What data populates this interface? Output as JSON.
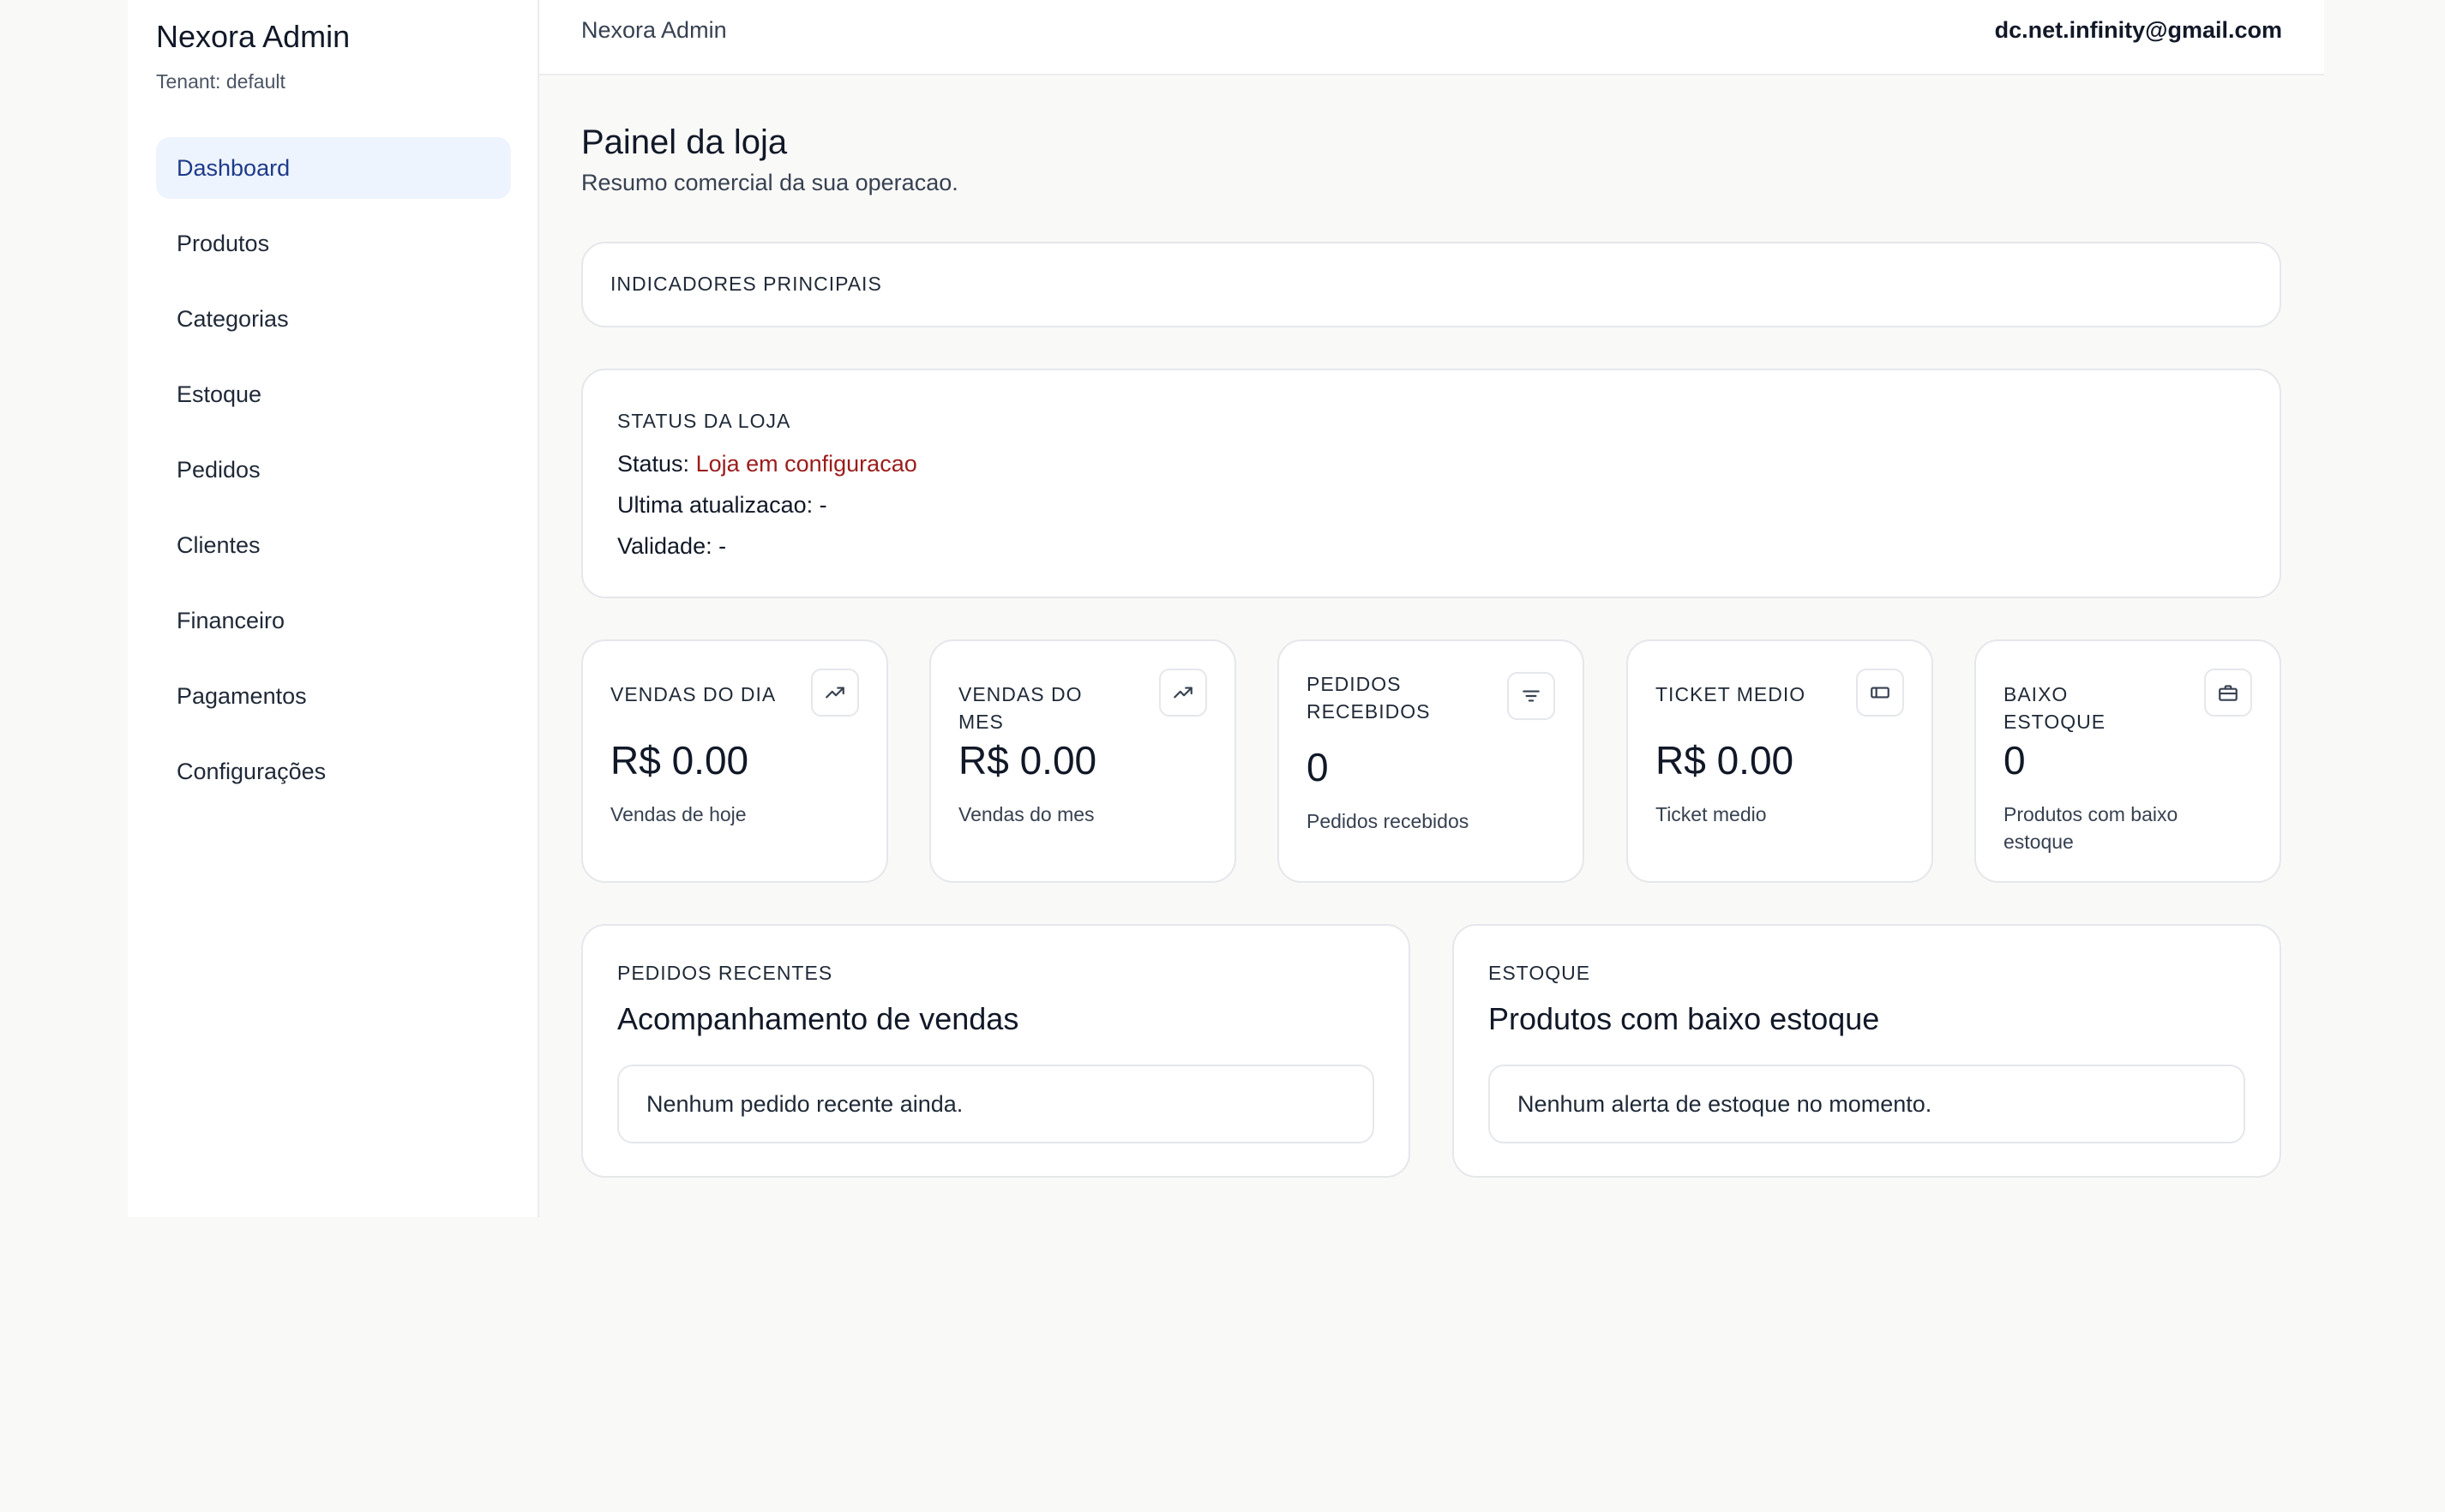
{
  "sidebar": {
    "brand": "Nexora Admin",
    "tenant": "Tenant: default",
    "items": [
      {
        "label": "Dashboard"
      },
      {
        "label": "Produtos"
      },
      {
        "label": "Categorias"
      },
      {
        "label": "Estoque"
      },
      {
        "label": "Pedidos"
      },
      {
        "label": "Clientes"
      },
      {
        "label": "Financeiro"
      },
      {
        "label": "Pagamentos"
      },
      {
        "label": "Configurações"
      }
    ]
  },
  "topbar": {
    "title": "Nexora Admin",
    "email": "dc.net.infinity@gmail.com"
  },
  "page": {
    "title": "Painel da loja",
    "subtitle": "Resumo comercial da sua operacao."
  },
  "indicators": {
    "label": "INDICADORES PRINCIPAIS"
  },
  "status": {
    "label": "STATUS DA LOJA",
    "status_key": "Status:",
    "status_value": "Loja em configuracao",
    "updated_key": "Ultima atualizacao:",
    "updated_value": "-",
    "validity_key": "Validade:",
    "validity_value": "-"
  },
  "metrics": [
    {
      "label": "VENDAS DO DIA",
      "value": "R$ 0.00",
      "desc": "Vendas de hoje",
      "icon": "trend-up-icon"
    },
    {
      "label": "VENDAS DO MES",
      "value": "R$ 0.00",
      "desc": "Vendas do mes",
      "icon": "trend-up-icon"
    },
    {
      "label": "PEDIDOS RECEBIDOS",
      "value": "0",
      "desc": "Pedidos recebidos",
      "icon": "filter-icon"
    },
    {
      "label": "TICKET MEDIO",
      "value": "R$ 0.00",
      "desc": "Ticket medio",
      "icon": "ticket-icon"
    },
    {
      "label": "BAIXO ESTOQUE",
      "value": "0",
      "desc": "Produtos com baixo estoque",
      "icon": "briefcase-icon"
    }
  ],
  "recent_orders": {
    "label": "PEDIDOS RECENTES",
    "title": "Acompanhamento de vendas",
    "empty": "Nenhum pedido recente ainda."
  },
  "stock": {
    "label": "ESTOQUE",
    "title": "Produtos com baixo estoque",
    "empty": "Nenhum alerta de estoque no momento."
  },
  "colors": {
    "accent_bg": "#eef4fd",
    "accent_text": "#1e3a8a",
    "status_red": "#9b1c1c"
  }
}
